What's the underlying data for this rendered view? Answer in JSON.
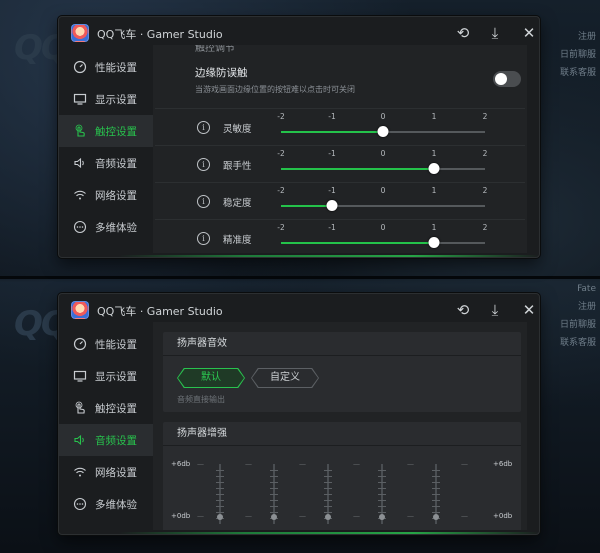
{
  "app": {
    "title": "QQ飞车 · Gamer Studio"
  },
  "background": {
    "logo_text": "QQ",
    "side_labels_top": [
      "注册",
      "日前聊服",
      "联系客服"
    ],
    "side_labels_bottom": [
      "Fate",
      "注册",
      "日前聊服",
      "联系客服"
    ]
  },
  "sidebar": {
    "items": [
      {
        "label": "性能设置",
        "icon": "gauge-icon"
      },
      {
        "label": "显示设置",
        "icon": "monitor-icon"
      },
      {
        "label": "触控设置",
        "icon": "touch-hand-icon"
      },
      {
        "label": "音频设置",
        "icon": "speaker-icon"
      },
      {
        "label": "网络设置",
        "icon": "wifi-icon"
      },
      {
        "label": "多维体验",
        "icon": "dots-circle-icon"
      }
    ]
  },
  "touch": {
    "cut_label": "触控调节",
    "edge_guard": {
      "title": "边缘防误触",
      "subtitle": "当游戏画面边缘位置的按钮难以点击时可关闭",
      "enabled": false
    },
    "tick_labels": [
      "-2",
      "-1",
      "0",
      "1",
      "2"
    ],
    "sliders": [
      {
        "label": "灵敏度",
        "value": 0
      },
      {
        "label": "跟手性",
        "value": 1
      },
      {
        "label": "稳定度",
        "value": -1
      },
      {
        "label": "精准度",
        "value": 1
      }
    ]
  },
  "audio": {
    "speaker_effect": {
      "title": "扬声器音效",
      "options": [
        "默认",
        "自定义"
      ],
      "selected": "默认",
      "note": "音频直接输出"
    },
    "speaker_boost": {
      "title": "扬声器增强",
      "top_label": "+6db",
      "bottom_label": "+0db"
    }
  },
  "colors": {
    "accent": "#28c24d",
    "panel_bg": "#1b1d1f",
    "content_bg": "#212325"
  }
}
